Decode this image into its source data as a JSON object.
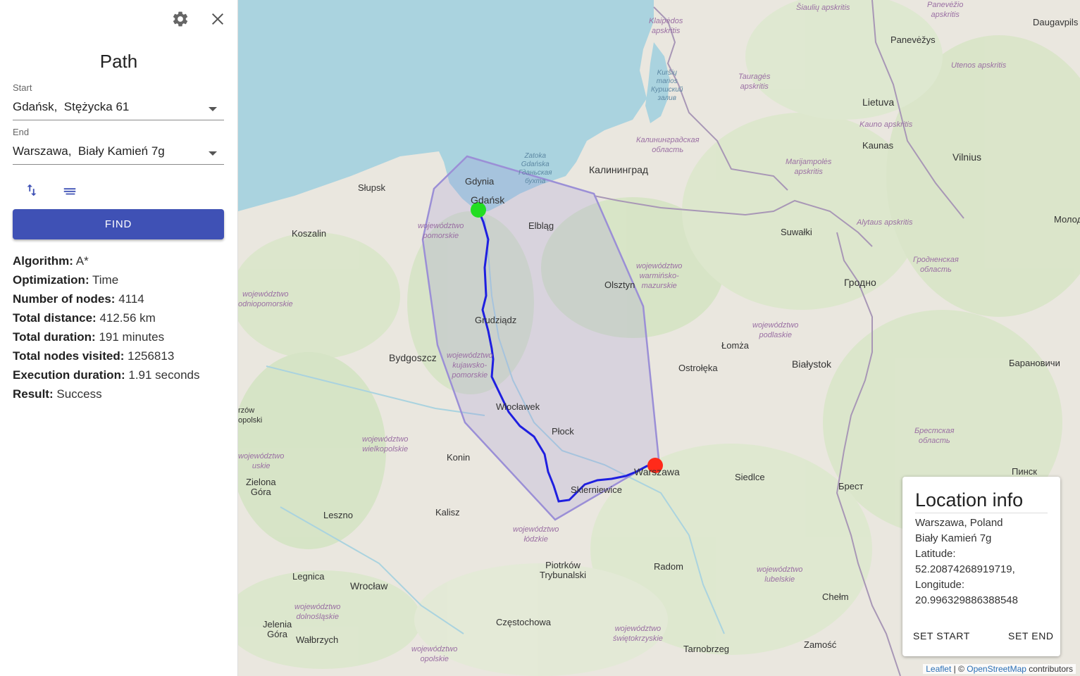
{
  "sidebar": {
    "title": "Path",
    "start": {
      "label": "Start",
      "value": "Gdańsk,  Stężycka 61"
    },
    "end": {
      "label": "End",
      "value": "Warszawa,  Biały Kamień 7g"
    },
    "icons": {
      "settings": "gear-icon",
      "close": "close-icon",
      "swap": "swap-vertical-icon",
      "details": "list-lines-icon"
    },
    "find_label": "FIND",
    "stats": [
      {
        "label": "Algorithm:",
        "value": "A*"
      },
      {
        "label": "Optimization:",
        "value": "Time"
      },
      {
        "label": "Number of nodes:",
        "value": "4114"
      },
      {
        "label": "Total distance:",
        "value": "412.56 km"
      },
      {
        "label": "Total duration:",
        "value": "191 minutes"
      },
      {
        "label": "Total nodes visited:",
        "value": "1256813"
      },
      {
        "label": "Execution duration:",
        "value": "1.91 seconds"
      },
      {
        "label": "Result:",
        "value": "Success"
      }
    ]
  },
  "map": {
    "labels": {
      "gdynia": "Gdynia",
      "gdansk": "Gdańsk",
      "slupsk": "Słupsk",
      "koszalin": "Koszalin",
      "elblag": "Elbląg",
      "olsztyn": "Olsztyn",
      "grudziadz": "Grudziądz",
      "bydgoszcz": "Bydgoszcz",
      "wloclawek": "Włocławek",
      "plock": "Płock",
      "konin": "Konin",
      "warszawa": "Warszawa",
      "skierniewice": "Skierniewice",
      "kalisz": "Kalisz",
      "leszno": "Leszno",
      "zielona_gora": "Zielona\nGóra",
      "wroclaw": "Wrocław",
      "legnica": "Legnica",
      "jelenia_gora": "Jelenia\nGóra",
      "walbrzych": "Wałbrzych",
      "czestochowa": "Częstochowa",
      "piotrkow": "Piotrków\nTrybunalski",
      "radom": "Radom",
      "tarnobrzeg": "Tarnobrzeg",
      "zamosc": "Zamość",
      "chelm": "Chełm",
      "siedlce": "Siedlce",
      "lomza": "Łomża",
      "ostroleka": "Ostrołęka",
      "bialystok": "Białystok",
      "suwalki": "Suwałki",
      "kaliningrad": "Калининград",
      "vilnius": "Vilnius",
      "kaunas": "Kaunas",
      "lietuva": "Lietuva",
      "panevezys": "Panevėžys",
      "daugavpils": "Daugavpils",
      "grodno": "Гродно",
      "brest": "Брест",
      "pinsk": "Пинск",
      "baranovichi": "Барановичи",
      "molod": "Молод",
      "klaipedos": "Klaipėdos\napskritis",
      "siauliu": "Šiaulių apskritis",
      "panevezio": "Panevėžio\napskritis",
      "taurages": "Tauragės\napskritis",
      "utenos": "Utenos apskritis",
      "kauno": "Kauno apskritis",
      "marijampoles": "Marijampolės\napskritis",
      "alytaus": "Alytaus apskritis",
      "kaliningrad_obl": "Калининградская\nобласть",
      "grodno_obl": "Гродненская\nобласть",
      "brest_obl": "Брестская\nобласть",
      "pomorskie": "województwo\npomorskie",
      "warminsko": "województwo\nwarmińsko-\nmazurskie",
      "podlaskie": "województwo\npodlaskie",
      "kujawsko": "województwo\nkujawsko-\npomorskie",
      "zachodniopomorskie": "województwo\nodniopomorskie",
      "wielkopolskie": "województwo\nwielkopolskie",
      "lodzkie": "województwo\nłódzkie",
      "lubelskie": "województwo\nlubelskie",
      "dolnoslaskie": "województwo\ndolnośląskie",
      "opolskie": "województwo\nopolskie",
      "swietokrzyskie": "województwo\nświętokrzyskie",
      "lubuskie": "województwo\nuskie",
      "gorzow": "rzów\nopolski",
      "zatoka": "Zatoka\nGdańska\nГданьская\nбухта",
      "kursiu": "Kuršių\nmarios\nКуршский\nзалив"
    }
  },
  "location_info": {
    "title": "Location info",
    "lines": [
      "Warszawa, Poland",
      "Biały Kamień 7g",
      "Latitude:",
      "52.20874268919719,",
      "Longitude:",
      "20.996329886388548"
    ],
    "set_start": "SET START",
    "set_end": "SET END"
  },
  "attribution": {
    "leaflet": "Leaflet",
    "sep": " | © ",
    "osm": "OpenStreetMap",
    "suffix": " contributors"
  },
  "colors": {
    "primary": "#3f51b5",
    "route": "#1f1fe0",
    "start_marker": "#22dd22",
    "end_marker": "#ff2a1a",
    "hull": "#9b8fd6"
  }
}
